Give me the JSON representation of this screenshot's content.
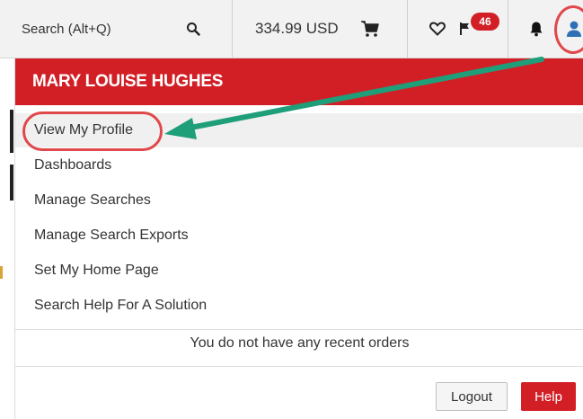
{
  "topbar": {
    "search_label": "Search (Alt+Q)",
    "cart_total": "334.99 USD",
    "notifications_count": "46",
    "icons": {
      "search": "search-icon",
      "cart": "cart-icon",
      "wishlist": "heart-icon",
      "flag": "flag-icon",
      "alerts": "bell-icon",
      "account": "user-icon"
    }
  },
  "dropdown": {
    "user_name": "MARY LOUISE HUGHES",
    "items": [
      {
        "label": "View My Profile"
      },
      {
        "label": "Dashboards"
      },
      {
        "label": "Manage Searches"
      },
      {
        "label": "Manage Search Exports"
      },
      {
        "label": "Set My Home Page"
      },
      {
        "label": "Search Help For A Solution"
      }
    ],
    "recent_orders_text": "You do not have any recent orders",
    "logout_label": "Logout",
    "help_label": "Help"
  },
  "colors": {
    "brand_red": "#d21f26",
    "annotation_red": "#e0484b",
    "annotation_arrow": "#1f9e7a"
  }
}
